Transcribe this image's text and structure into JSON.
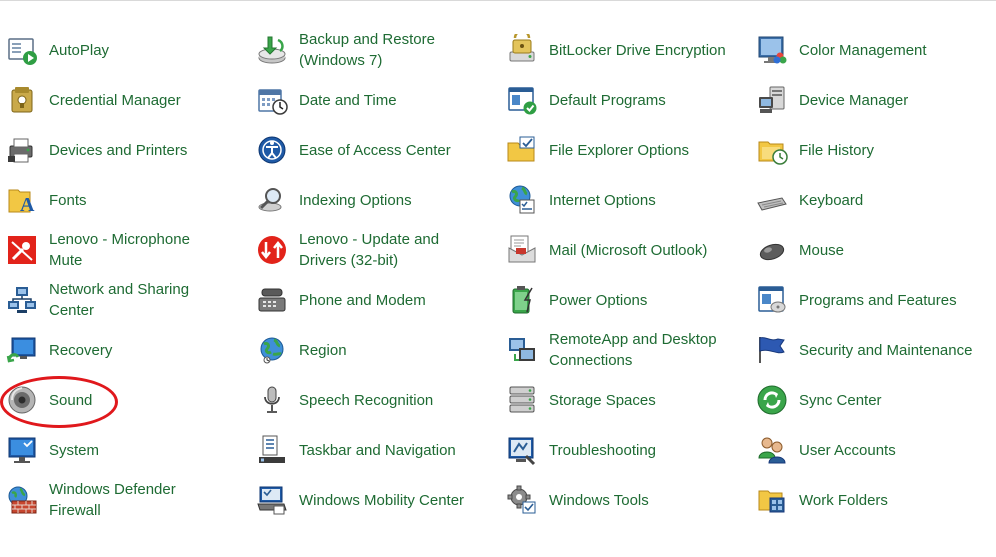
{
  "items": [
    {
      "label": "AutoPlay",
      "icon": "autoplay-icon"
    },
    {
      "label": "Backup and Restore (Windows 7)",
      "icon": "backup-restore-icon"
    },
    {
      "label": "BitLocker Drive Encryption",
      "icon": "bitlocker-icon"
    },
    {
      "label": "Color Management",
      "icon": "color-management-icon"
    },
    {
      "label": "Credential Manager",
      "icon": "credential-manager-icon"
    },
    {
      "label": "Date and Time",
      "icon": "date-time-icon"
    },
    {
      "label": "Default Programs",
      "icon": "default-programs-icon"
    },
    {
      "label": "Device Manager",
      "icon": "device-manager-icon"
    },
    {
      "label": "Devices and Printers",
      "icon": "devices-printers-icon"
    },
    {
      "label": "Ease of Access Center",
      "icon": "ease-of-access-icon"
    },
    {
      "label": "File Explorer Options",
      "icon": "file-explorer-options-icon"
    },
    {
      "label": "File History",
      "icon": "file-history-icon"
    },
    {
      "label": "Fonts",
      "icon": "fonts-icon"
    },
    {
      "label": "Indexing Options",
      "icon": "indexing-options-icon"
    },
    {
      "label": "Internet Options",
      "icon": "internet-options-icon"
    },
    {
      "label": "Keyboard",
      "icon": "keyboard-icon"
    },
    {
      "label": "Lenovo - Microphone Mute",
      "icon": "lenovo-microphone-mute-icon"
    },
    {
      "label": "Lenovo - Update and Drivers (32-bit)",
      "icon": "lenovo-update-icon"
    },
    {
      "label": "Mail (Microsoft Outlook)",
      "icon": "mail-icon"
    },
    {
      "label": "Mouse",
      "icon": "mouse-icon"
    },
    {
      "label": "Network and Sharing Center",
      "icon": "network-sharing-icon"
    },
    {
      "label": "Phone and Modem",
      "icon": "phone-modem-icon"
    },
    {
      "label": "Power Options",
      "icon": "power-options-icon"
    },
    {
      "label": "Programs and Features",
      "icon": "programs-features-icon"
    },
    {
      "label": "Recovery",
      "icon": "recovery-icon"
    },
    {
      "label": "Region",
      "icon": "region-icon"
    },
    {
      "label": "RemoteApp and Desktop Connections",
      "icon": "remoteapp-icon"
    },
    {
      "label": "Security and Maintenance",
      "icon": "security-maintenance-icon"
    },
    {
      "label": "Sound",
      "icon": "sound-icon"
    },
    {
      "label": "Speech Recognition",
      "icon": "speech-recognition-icon"
    },
    {
      "label": "Storage Spaces",
      "icon": "storage-spaces-icon"
    },
    {
      "label": "Sync Center",
      "icon": "sync-center-icon"
    },
    {
      "label": "System",
      "icon": "system-icon"
    },
    {
      "label": "Taskbar and Navigation",
      "icon": "taskbar-navigation-icon"
    },
    {
      "label": "Troubleshooting",
      "icon": "troubleshooting-icon"
    },
    {
      "label": "User Accounts",
      "icon": "user-accounts-icon"
    },
    {
      "label": "Windows Defender Firewall",
      "icon": "firewall-icon"
    },
    {
      "label": "Windows Mobility Center",
      "icon": "mobility-center-icon"
    },
    {
      "label": "Windows Tools",
      "icon": "windows-tools-icon"
    },
    {
      "label": "Work Folders",
      "icon": "work-folders-icon"
    }
  ],
  "colors": {
    "link": "#1e6b33",
    "highlight_circle": "#e0181c"
  }
}
